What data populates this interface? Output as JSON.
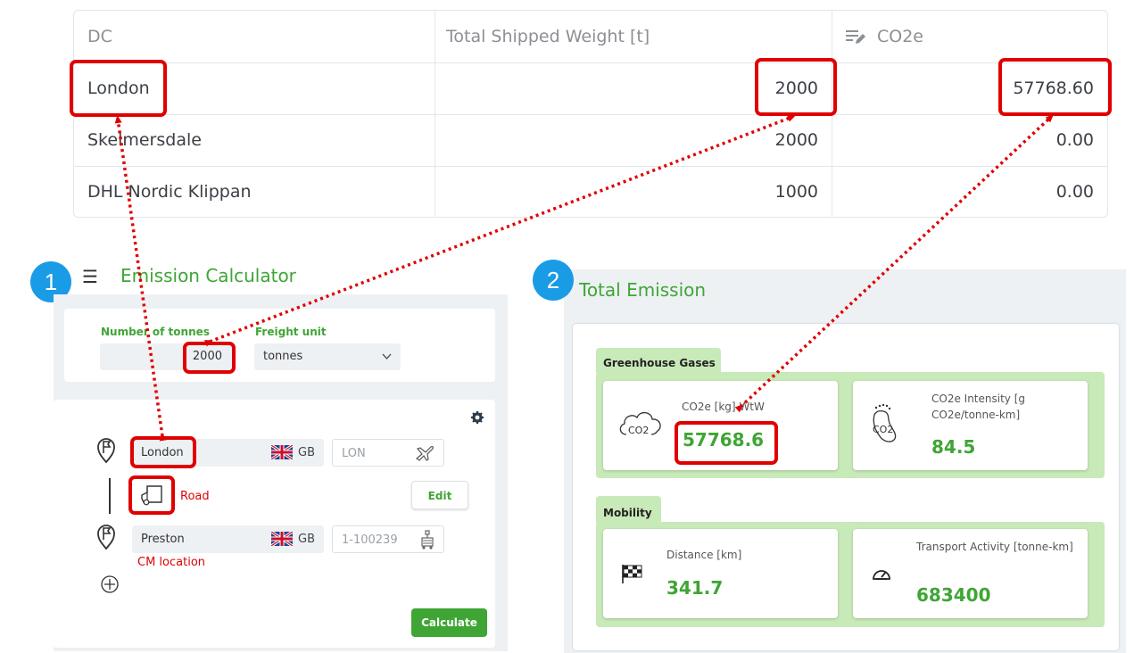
{
  "table": {
    "headers": [
      "DC",
      "Total Shipped Weight [t]",
      "CO2e"
    ],
    "rows": [
      {
        "dc": "London",
        "weight": "2000",
        "co2e": "57768.60"
      },
      {
        "dc": "Skelmersdale",
        "weight": "2000",
        "co2e": "0.00"
      },
      {
        "dc": "DHL Nordic Klippan",
        "weight": "1000",
        "co2e": "0.00"
      }
    ]
  },
  "badges": [
    "1",
    "2"
  ],
  "calculator": {
    "title": "Emission Calculator",
    "tonnes_label": "Number of tonnes",
    "tonnes_value": "2000",
    "freight_label": "Freight unit",
    "freight_value": "tonnes",
    "origin": {
      "city": "London",
      "country": "GB",
      "code_placeholder": "LON"
    },
    "transport": {
      "mode": "Road",
      "edit_label": "Edit"
    },
    "destination": {
      "city": "Preston",
      "country": "GB",
      "code_placeholder": "1-100239",
      "note": "CM location"
    },
    "calculate_label": "Calculate"
  },
  "emission": {
    "title": "Total Emission",
    "ghg_label": "Greenhouse Gases",
    "co2e_label": "CO2e [kg] WtW",
    "co2e_value": "57768.6",
    "intensity_label": "CO2e Intensity [g CO2e/tonne-km]",
    "intensity_value": "84.5",
    "mobility_label": "Mobility",
    "distance_label": "Distance [km]",
    "distance_value": "341.7",
    "activity_label": "Transport Activity [tonne-km]",
    "activity_value": "683400",
    "co2_icon_text": "CO2"
  },
  "colors": {
    "accent_green": "#3fa535",
    "callout_red": "#e00000",
    "badge_blue": "#1a9be6"
  }
}
